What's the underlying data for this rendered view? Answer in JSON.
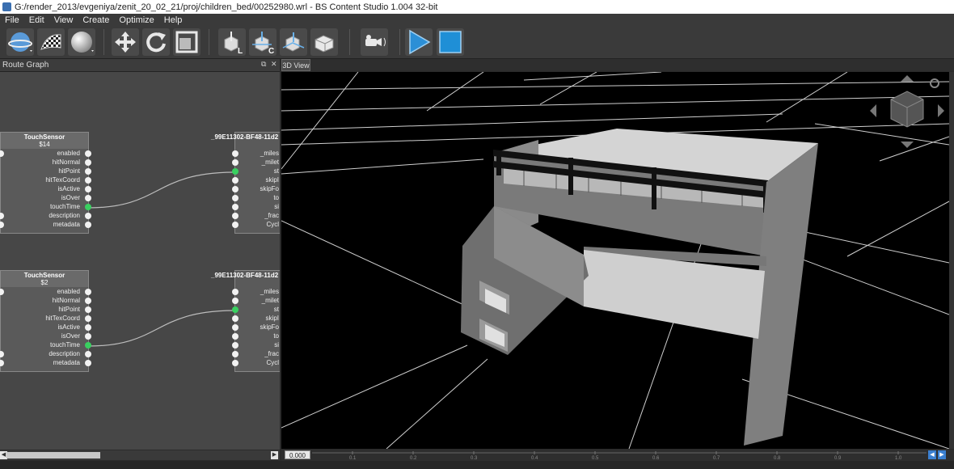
{
  "window": {
    "title": "G:/render_2013/evgeniya/zenit_20_02_21/proj/children_bed/00252980.wrl - BS Content Studio 1.004 32-bit"
  },
  "menu": [
    "File",
    "Edit",
    "View",
    "Create",
    "Optimize",
    "Help"
  ],
  "toolbar": {
    "icons": [
      "globe-view-icon",
      "checker-texture-icon",
      "sphere-material-icon",
      "move-icon",
      "rotate-icon",
      "scale-icon",
      "local-axis-icon",
      "center-axis-icon",
      "snap-grid-icon",
      "box-view-icon",
      "camera-icon",
      "play-icon",
      "stop-icon"
    ],
    "axis_labels": [
      "L",
      "C"
    ],
    "accent": "#2c8fd6"
  },
  "route_graph": {
    "title": "Route Graph",
    "nodes": [
      {
        "name": "TouchSensor",
        "id": "$14",
        "fields": [
          "enabled",
          "hitNormal",
          "hitPoint",
          "hitTexCoord",
          "isActive",
          "isOver",
          "touchTime",
          "description",
          "metadata"
        ]
      },
      {
        "name": "TouchSensor",
        "id": "$2",
        "fields": [
          "enabled",
          "hitNormal",
          "hitPoint",
          "hitTexCoord",
          "isActive",
          "isOver",
          "touchTime",
          "description",
          "metadata"
        ]
      }
    ],
    "targets": [
      {
        "name": "_99E11302-BF48-11d2",
        "fields": [
          "_miles",
          "_milet",
          "st",
          "skipI",
          "skipFo",
          "to",
          "si",
          "_frac",
          "Cycl"
        ]
      },
      {
        "name": "_99E11302-BF48-11d2",
        "fields": [
          "_miles",
          "_milet",
          "st",
          "skipI",
          "skipFo",
          "to",
          "si",
          "_frac",
          "Cycl"
        ]
      }
    ]
  },
  "view": {
    "tab": "3D View"
  },
  "timeline": {
    "value": "0.000",
    "ticks": [
      "0.1",
      "0.2",
      "0.3",
      "0.4",
      "0.5",
      "0.6",
      "0.7",
      "0.8",
      "0.9",
      "1.0"
    ]
  }
}
